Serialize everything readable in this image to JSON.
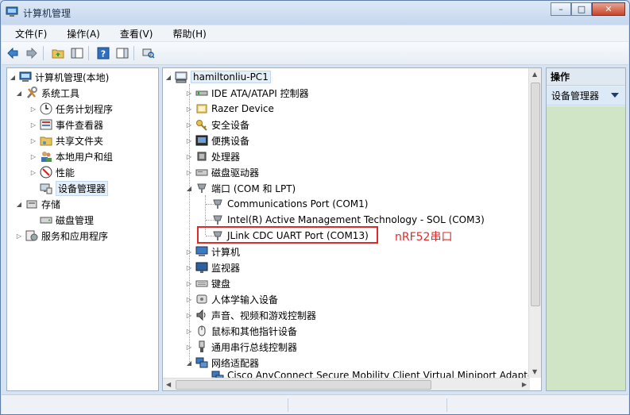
{
  "window": {
    "title": "计算机管理",
    "controls": {
      "minimize": "–",
      "maximize": "□",
      "close": "✕"
    }
  },
  "menubar": {
    "items": [
      {
        "label": "文件(F)"
      },
      {
        "label": "操作(A)"
      },
      {
        "label": "查看(V)"
      },
      {
        "label": "帮助(H)"
      }
    ]
  },
  "toolbar": {
    "buttons": [
      "back-icon",
      "forward-icon",
      "up-folder-icon",
      "show-hide-tree-icon",
      "help-icon",
      "show-hide-action-pane-icon",
      "scan-hardware-icon"
    ]
  },
  "left_tree": {
    "root": "计算机管理(本地)",
    "system_tools": "系统工具",
    "items": [
      {
        "label": "任务计划程序",
        "icon": "clock-icon"
      },
      {
        "label": "事件查看器",
        "icon": "event-viewer-icon"
      },
      {
        "label": "共享文件夹",
        "icon": "shared-folder-icon"
      },
      {
        "label": "本地用户和组",
        "icon": "users-icon"
      },
      {
        "label": "性能",
        "icon": "performance-icon"
      },
      {
        "label": "设备管理器",
        "icon": "device-manager-icon"
      }
    ],
    "storage": "存储",
    "disk_management": "磁盘管理",
    "services": "服务和应用程序"
  },
  "device_tree": {
    "root": "hamiltonliu-PC1",
    "categories": [
      {
        "label": "IDE ATA/ATAPI 控制器",
        "icon": "ide-controller-icon"
      },
      {
        "label": "Razer Device",
        "icon": "razer-device-icon"
      },
      {
        "label": "安全设备",
        "icon": "security-key-icon"
      },
      {
        "label": "便携设备",
        "icon": "portable-device-icon"
      },
      {
        "label": "处理器",
        "icon": "processor-icon"
      },
      {
        "label": "磁盘驱动器",
        "icon": "disk-drive-icon"
      },
      {
        "label": "端口 (COM 和 LPT)",
        "icon": "port-icon"
      }
    ],
    "ports": [
      {
        "label": "Communications Port (COM1)"
      },
      {
        "label": "Intel(R) Active Management Technology - SOL (COM3)"
      },
      {
        "label": "JLink CDC UART Port (COM13)"
      }
    ],
    "categories_after": [
      {
        "label": "计算机",
        "icon": "computer-icon"
      },
      {
        "label": "监视器",
        "icon": "monitor-icon"
      },
      {
        "label": "键盘",
        "icon": "keyboard-icon"
      },
      {
        "label": "人体学输入设备",
        "icon": "hid-icon"
      },
      {
        "label": "声音、视频和游戏控制器",
        "icon": "sound-icon"
      },
      {
        "label": "鼠标和其他指针设备",
        "icon": "mouse-icon"
      },
      {
        "label": "通用串行总线控制器",
        "icon": "usb-icon"
      },
      {
        "label": "网络适配器",
        "icon": "network-adapter-icon"
      }
    ],
    "network_child": "Cisco AnyConnect Secure Mobility Client Virtual Miniport Adapter"
  },
  "annotation": "nRF52串口",
  "actions_pane": {
    "title": "操作",
    "item": "设备管理器"
  },
  "colors": {
    "highlight": "#e02a2a",
    "actions_green": "#cfe5c6"
  }
}
